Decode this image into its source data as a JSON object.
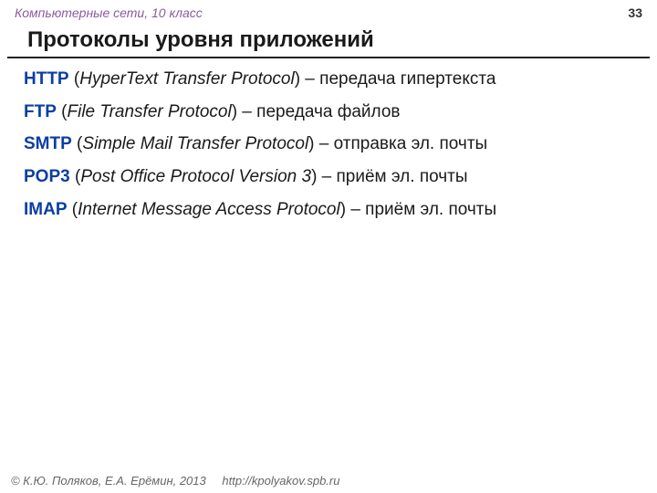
{
  "header": {
    "subject": "Компьютерные сети, 10 класс",
    "slide_number": "33"
  },
  "title": "Протоколы уровня приложений",
  "protocols": [
    {
      "abbr": "HTTP",
      "expansion": "HyperText Transfer Protocol",
      "desc": "передача гипертекста"
    },
    {
      "abbr": "FTP",
      "expansion": "File Transfer Protocol",
      "desc": "передача файлов"
    },
    {
      "abbr": "SMTP",
      "expansion": "Simple Mail Transfer Protocol",
      "desc": "отправка эл. почты"
    },
    {
      "abbr": "POP3",
      "expansion": "Post Office Protocol Version 3",
      "desc": "приём эл. почты"
    },
    {
      "abbr": "IMAP",
      "expansion": "Internet Message Access Protocol",
      "desc": "приём эл. почты"
    }
  ],
  "footer": {
    "copyright": "© К.Ю. Поляков, Е.А. Ерёмин, 2013",
    "url": "http://kpolyakov.spb.ru"
  }
}
